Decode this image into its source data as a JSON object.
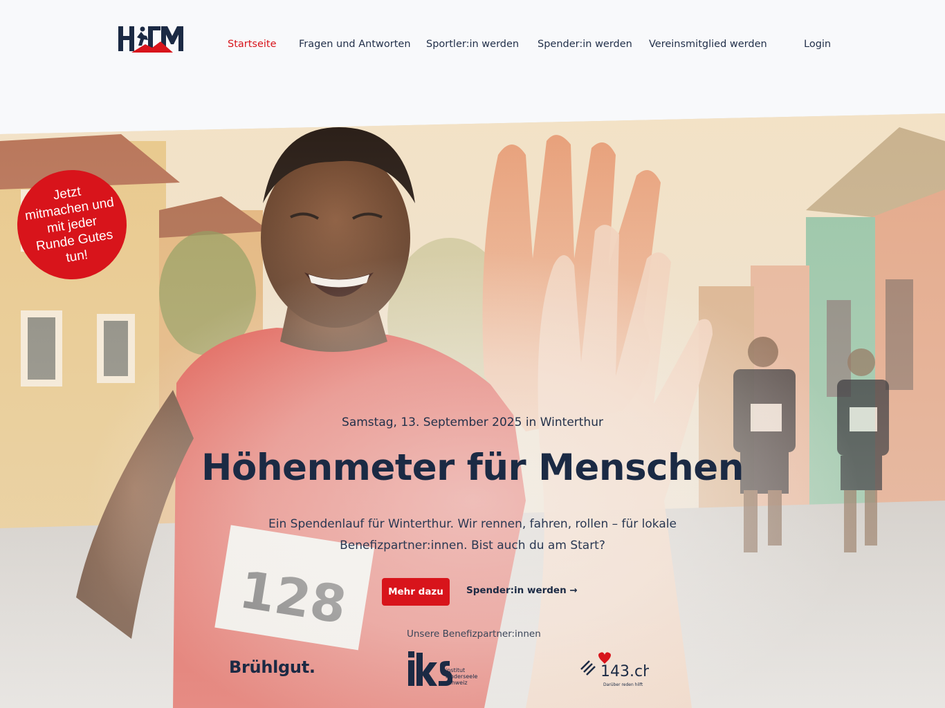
{
  "header": {
    "logo_alt": "HFM",
    "nav": [
      {
        "label": "Startseite",
        "active": true
      },
      {
        "label": "Fragen und Antworten",
        "active": false
      },
      {
        "label": "Sportler:in werden",
        "active": false
      },
      {
        "label": "Spender:in werden",
        "active": false
      },
      {
        "label": "Vereinsmitglied werden",
        "active": false
      }
    ],
    "login": "Login"
  },
  "badge": {
    "text": "Jetzt mitmachen und mit jeder Runde Gutes tun!"
  },
  "hero": {
    "bib_number": "128",
    "date": "Samstag, 13. September 2025 in Winterthur",
    "title": "Höhenmeter für Menschen",
    "lead": "Ein Spendenlauf für Winterthur. Wir rennen, fahren, rollen – für lokale Benefizpartner:innen. Bist auch du am Start?",
    "cta_primary": "Mehr dazu",
    "cta_secondary": "Spender:in werden →"
  },
  "partners": {
    "label": "Unsere Benefizpartner:innen",
    "items": [
      {
        "name": "Brühlgut."
      },
      {
        "name": "iks",
        "sub": [
          "institut",
          "kinderseele",
          "schweiz"
        ]
      },
      {
        "name": "143.ch",
        "tagline": "Darüber reden hilft"
      }
    ]
  },
  "colors": {
    "accent": "#d8141b",
    "navy": "#1b2a44",
    "background": "#f8f9fb"
  }
}
